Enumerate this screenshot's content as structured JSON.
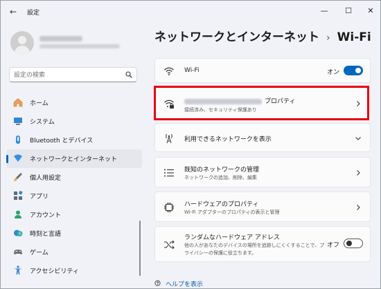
{
  "window": {
    "title": "設定",
    "back_icon": "back-arrow-icon",
    "minimize_glyph": "—",
    "maximize_glyph": "☐",
    "close_glyph": "✕"
  },
  "search": {
    "placeholder": "設定の検索"
  },
  "sidebar": {
    "items": [
      {
        "label": "ホーム",
        "icon": "home-icon",
        "active": false
      },
      {
        "label": "システム",
        "icon": "system-icon",
        "active": false
      },
      {
        "label": "Bluetooth とデバイス",
        "icon": "bluetooth-icon",
        "active": false
      },
      {
        "label": "ネットワークとインターネット",
        "icon": "network-icon",
        "active": true
      },
      {
        "label": "個人用設定",
        "icon": "brush-icon",
        "active": false
      },
      {
        "label": "アプリ",
        "icon": "apps-icon",
        "active": false
      },
      {
        "label": "アカウント",
        "icon": "account-icon",
        "active": false
      },
      {
        "label": "時刻と言語",
        "icon": "time-language-icon",
        "active": false
      },
      {
        "label": "ゲーム",
        "icon": "game-icon",
        "active": false
      },
      {
        "label": "アクセシビリティ",
        "icon": "accessibility-icon",
        "active": false
      }
    ]
  },
  "breadcrumb": {
    "parent": "ネットワークとインターネット",
    "separator": "›",
    "current": "Wi-Fi"
  },
  "wifi": {
    "label": "Wi-Fi",
    "state": "オン",
    "enabled": true
  },
  "properties": {
    "title_suffix": "プロパティ",
    "subtitle": "接続済み、セキュリティ保護あり"
  },
  "available": {
    "label": "利用できるネットワークを表示"
  },
  "known": {
    "title": "既知のネットワークの管理",
    "subtitle": "ネットワークの追加、削除、編集"
  },
  "hardware": {
    "title": "ハードウェアのプロパティ",
    "subtitle": "Wi-Fi アダプターのプロパティの表示と管理"
  },
  "random_mac": {
    "title": "ランダムなハードウェア アドレス",
    "subtitle_line1": "他の人があなたのデバイスの場所を追跡しにくくすることで、プ",
    "subtitle_line2": "ライバシーの保護に役立ちます。",
    "state": "オフ",
    "enabled": false
  },
  "help": {
    "label": "ヘルプを表示"
  },
  "colors": {
    "accent": "#0067c0",
    "highlight_border": "#e60012"
  }
}
